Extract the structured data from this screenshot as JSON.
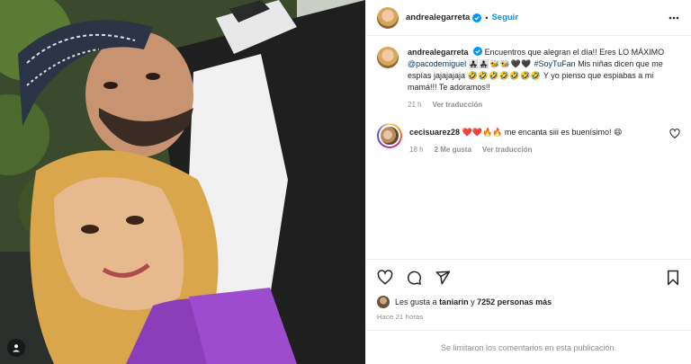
{
  "post": {
    "username": "andrealegarreta",
    "follow_label": "Seguir",
    "dot": "•"
  },
  "caption": {
    "username": "andrealegarreta",
    "text_1": "Encuentros que alegran el día!! Eres LO MÁXIMO",
    "mention": "@pacodemiguel",
    "emojis_1": "👨‍👧‍👧👨‍👧‍👧🐝🐝🖤🖤",
    "hashtag": "#SoyTuFan",
    "text_2": "Mis niñas dicen que me espías jajajajaja",
    "emojis_2": "🤣🤣🤣🤣🤣🤣🤣",
    "text_3": "Y yo pienso que espiabas a mi mamá!!! Te adoramos!!",
    "time": "21 h",
    "translate": "Ver traducción"
  },
  "comment": {
    "username": "cecisuarez28",
    "emojis": "❤️❤️🔥🔥",
    "text": "me encanta siii es buenísimo!",
    "emoji_end": "😄",
    "time": "18 h",
    "likes": "2 Me gusta",
    "translate": "Ver traducción"
  },
  "likes": {
    "prefix": "Les gusta a",
    "user": "taniarin",
    "connector": "y",
    "count": "7252 personas más"
  },
  "posted_ago": "Hace 21 horas",
  "comments_limited": "Se limitaron los comentarios en esta publicación.",
  "icons": [
    "verified-icon",
    "more-icon",
    "heart-icon",
    "comment-icon",
    "share-icon",
    "bookmark-icon",
    "tag-user-icon"
  ],
  "colors": {
    "accent": "#0095f6",
    "text": "#262626",
    "muted": "#8e8e8e",
    "border": "#efefef"
  }
}
